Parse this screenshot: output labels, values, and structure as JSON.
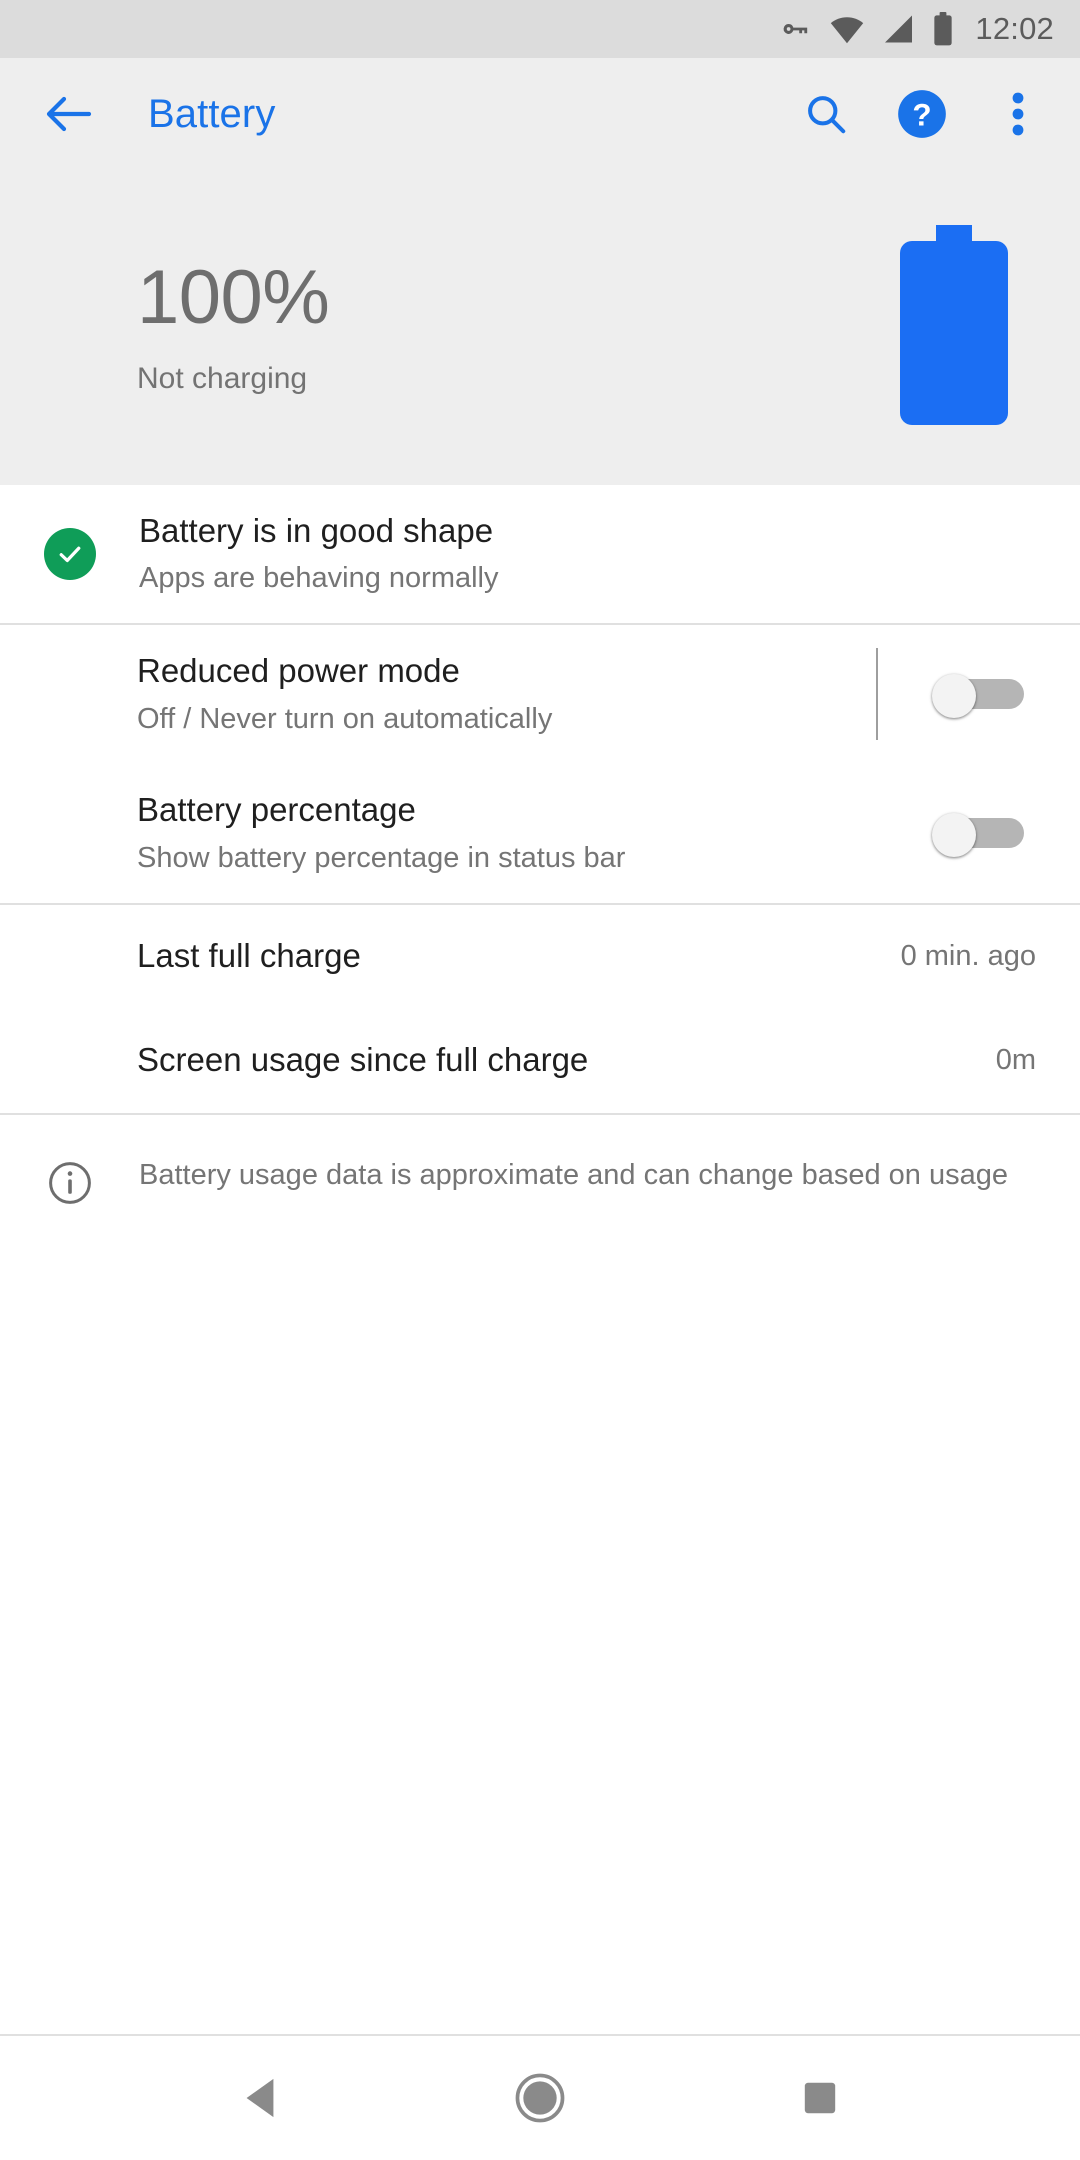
{
  "status_bar": {
    "time": "12:02",
    "icons": [
      "vpn-key-icon",
      "wifi-icon",
      "cellular-signal-icon",
      "battery-icon"
    ]
  },
  "app_bar": {
    "back_label": "back-arrow-icon",
    "title": "Battery",
    "actions": [
      "search-icon",
      "help-icon",
      "overflow-menu-icon"
    ],
    "accent_color": "#1a73e8"
  },
  "hero": {
    "percentage": "100%",
    "charge_state": "Not charging",
    "battery_fill_color": "#1b6ef3"
  },
  "status_row": {
    "title": "Battery is in good shape",
    "subtitle": "Apps are behaving normally",
    "icon": "green-check-circle-icon",
    "icon_color": "#0f9d58"
  },
  "toggles": [
    {
      "title": "Reduced power mode",
      "subtitle": "Off / Never turn on automatically",
      "checked": false,
      "has_separator": true
    },
    {
      "title": "Battery percentage",
      "subtitle": "Show battery percentage in status bar",
      "checked": false,
      "has_separator": false
    }
  ],
  "values": [
    {
      "title": "Last full charge",
      "value": "0 min. ago"
    },
    {
      "title": "Screen usage since full charge",
      "value": "0m"
    }
  ],
  "note": {
    "text": "Battery usage data is approximate and can change based on usage",
    "icon": "info-circle-icon"
  },
  "nav_bar": {
    "back": "nav-back-triangle-icon",
    "home": "nav-home-circle-icon",
    "recents": "nav-recents-square-icon"
  }
}
